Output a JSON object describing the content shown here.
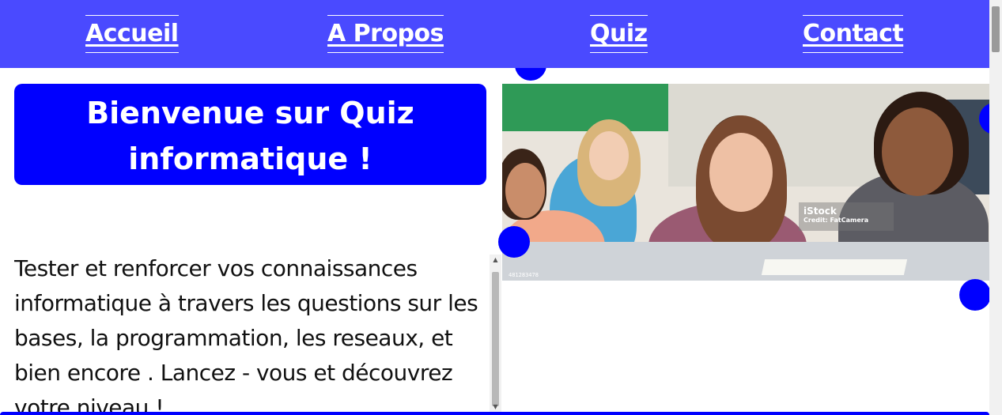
{
  "nav": {
    "items": [
      {
        "label": "Accueil"
      },
      {
        "label": "A Propos"
      },
      {
        "label": "Quiz"
      },
      {
        "label": "Contact"
      }
    ],
    "background": "#4a4aff"
  },
  "hero": {
    "title_line1": "Bienvenue sur Quiz",
    "title_line2": "informatique !",
    "background": "#0000ff"
  },
  "description": {
    "text": "Tester et renforcer vos connaissances informatique à travers les questions sur les bases, la programmation, les reseaux, et bien encore . Lancez - vous et découvrez votre niveau !"
  },
  "image": {
    "watermark_brand": "iStock",
    "watermark_credit": "Credit: FatCamera",
    "stock_id": "481283478"
  },
  "colors": {
    "accent": "#0000ff",
    "nav_text": "#ffffff"
  }
}
